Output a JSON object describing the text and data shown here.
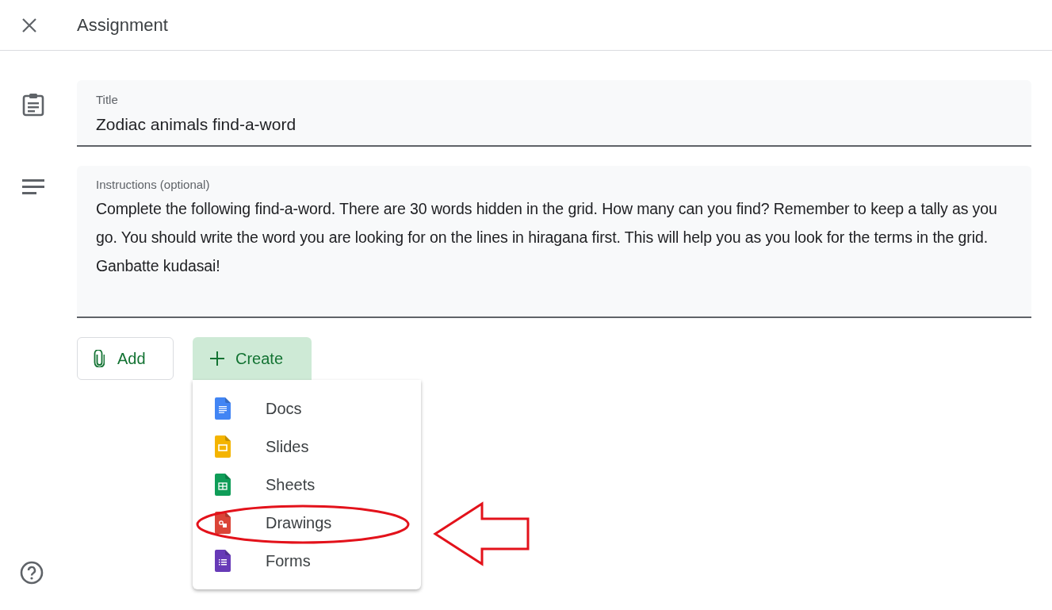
{
  "header": {
    "title": "Assignment"
  },
  "title_field": {
    "label": "Title",
    "value": "Zodiac animals find-a-word"
  },
  "instructions_field": {
    "label": "Instructions (optional)",
    "value": "Complete the following find-a-word. There are 30 words hidden in the grid. How many can you find? Remember to keep a tally as you go. You should write the word you are looking for on the lines in hiragana first. This will help you as you look for the terms in the grid. Ganbatte kudasai!"
  },
  "buttons": {
    "add": "Add",
    "create": "Create"
  },
  "create_menu": [
    {
      "kind": "docs",
      "label": "Docs"
    },
    {
      "kind": "slides",
      "label": "Slides"
    },
    {
      "kind": "sheets",
      "label": "Sheets"
    },
    {
      "kind": "drawings",
      "label": "Drawings"
    },
    {
      "kind": "forms",
      "label": "Forms"
    }
  ]
}
